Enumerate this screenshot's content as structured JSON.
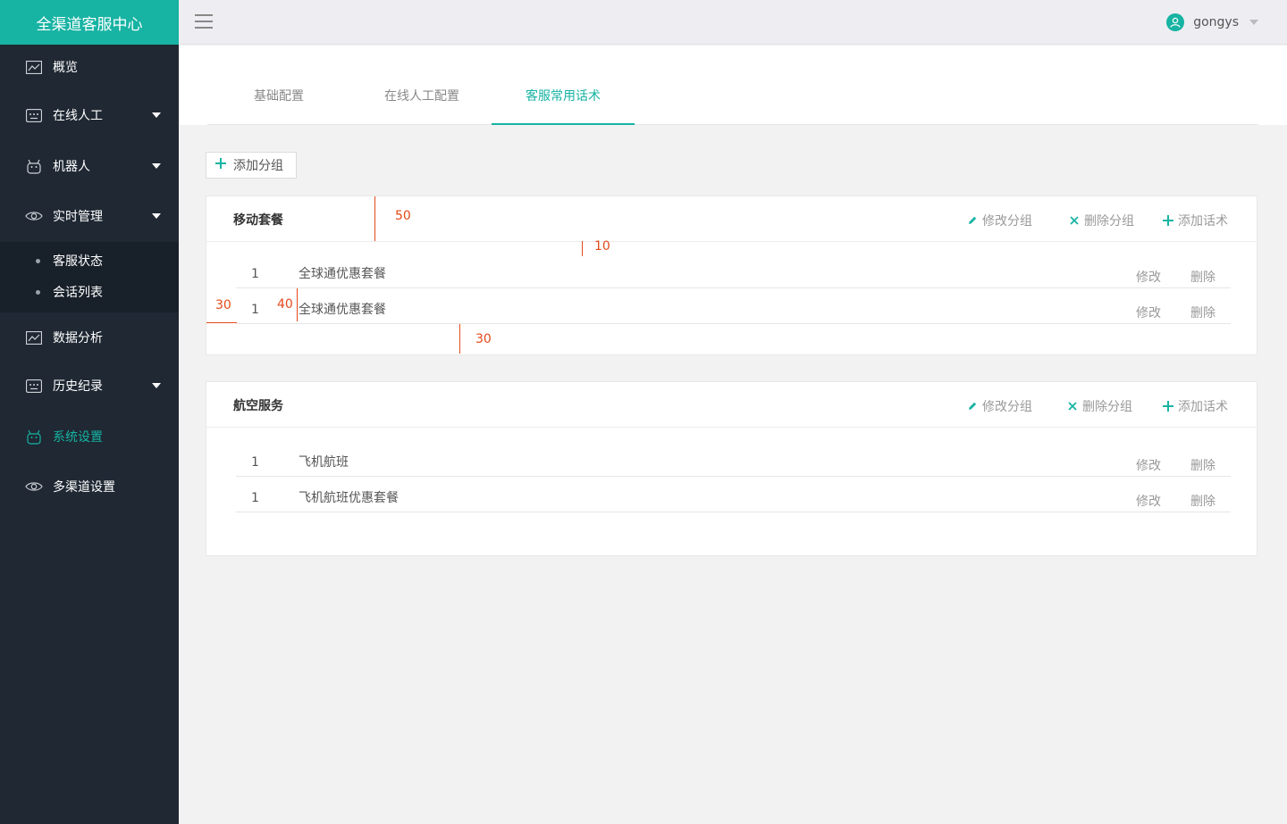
{
  "app": {
    "title": "全渠道客服中心"
  },
  "sidebar": {
    "items": [
      {
        "label": "概览"
      },
      {
        "label": "在线人工"
      },
      {
        "label": "机器人"
      },
      {
        "label": "实时管理"
      },
      {
        "label": "数据分析"
      },
      {
        "label": "历史纪录"
      },
      {
        "label": "系统设置"
      },
      {
        "label": "多渠道设置"
      }
    ],
    "submenu": [
      {
        "label": "客服状态"
      },
      {
        "label": "会话列表"
      }
    ],
    "active_item": "系统设置",
    "accent_color": "#17b3a3"
  },
  "header": {
    "user": {
      "name": "gongys"
    }
  },
  "tabs": [
    {
      "label": "基础配置"
    },
    {
      "label": "在线人工配置"
    },
    {
      "label": "客服常用话术"
    }
  ],
  "active_tab": "客服常用话术",
  "toolbar": {
    "add_group_label": "添加分组"
  },
  "groups": [
    {
      "title": "移动套餐",
      "actions": {
        "edit": "修改分组",
        "delete": "删除分组",
        "add": "添加话术"
      },
      "rows": [
        {
          "num": "1",
          "text": "全球通优惠套餐",
          "edit": "修改",
          "delete": "删除"
        },
        {
          "num": "1",
          "text": "全球通优惠套餐",
          "edit": "修改",
          "delete": "删除"
        }
      ]
    },
    {
      "title": "航空服务",
      "actions": {
        "edit": "修改分组",
        "delete": "删除分组",
        "add": "添加话术"
      },
      "rows": [
        {
          "num": "1",
          "text": "飞机航班",
          "edit": "修改",
          "delete": "删除"
        },
        {
          "num": "1",
          "text": "飞机航班优惠套餐",
          "edit": "修改",
          "delete": "删除"
        }
      ]
    }
  ],
  "annotations": {
    "a50": "50",
    "a10": "10",
    "a30_left": "30",
    "a40": "40",
    "a30_bottom": "30"
  },
  "annotation_color": "#e24a1a"
}
